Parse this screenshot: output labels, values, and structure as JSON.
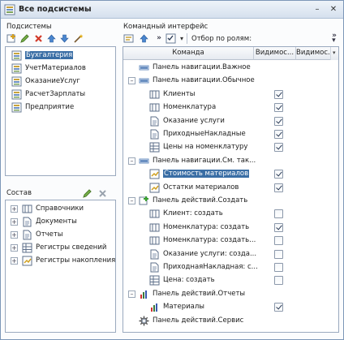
{
  "window": {
    "title": "Все подсистемы",
    "minimize": "–",
    "close": "✕"
  },
  "subsystems": {
    "label": "Подсистемы",
    "items": [
      "Бухгалтерия",
      "УчетМатериалов",
      "ОказаниеУслуг",
      "РасчетЗарплаты",
      "Предприятие"
    ]
  },
  "composition": {
    "label": "Состав",
    "items": [
      "Справочники",
      "Документы",
      "Отчеты",
      "Регистры сведений",
      "Регистры накопления"
    ]
  },
  "commands": {
    "label": "Командный интерфейс",
    "filter_label": "Отбор по ролям:",
    "columns": [
      "Команда",
      "Видимос...",
      "Видимос..."
    ],
    "rows": [
      {
        "text": "Панель навигации.Важное",
        "kind": "group",
        "checked": null
      },
      {
        "text": "Панель навигации.Обычное",
        "kind": "group",
        "checked": null
      },
      {
        "text": "Клиенты",
        "kind": "catalog",
        "checked": true
      },
      {
        "text": "Номенклатура",
        "kind": "catalog",
        "checked": true
      },
      {
        "text": "Оказание услуги",
        "kind": "doc",
        "checked": true
      },
      {
        "text": "ПриходныеНакладные",
        "kind": "doc",
        "checked": true
      },
      {
        "text": "Цены на номенклатуру",
        "kind": "register",
        "checked": true
      },
      {
        "text": "Панель навигации.См. так...",
        "kind": "group",
        "checked": null
      },
      {
        "text": "Стоимость материалов",
        "kind": "accum",
        "checked": true,
        "selected": true
      },
      {
        "text": "Остатки материалов",
        "kind": "accum",
        "checked": true
      },
      {
        "text": "Панель действий.Создать",
        "kind": "create",
        "checked": null
      },
      {
        "text": "Клиент: создать",
        "kind": "catalog",
        "checked": false
      },
      {
        "text": "Номенклатура: создать",
        "kind": "catalog",
        "checked": true
      },
      {
        "text": "Номенклатура: создать...",
        "kind": "catalog",
        "checked": false
      },
      {
        "text": "Оказание услуги: созда...",
        "kind": "doc",
        "checked": false
      },
      {
        "text": "ПриходнаяНакладная: с...",
        "kind": "doc",
        "checked": false
      },
      {
        "text": "Цена: создать",
        "kind": "register",
        "checked": false
      },
      {
        "text": "Панель действий.Отчеты",
        "kind": "report",
        "checked": null
      },
      {
        "text": "Материалы",
        "kind": "report",
        "checked": true
      },
      {
        "text": "Панель действий.Сервис",
        "kind": "service",
        "checked": null
      }
    ]
  }
}
